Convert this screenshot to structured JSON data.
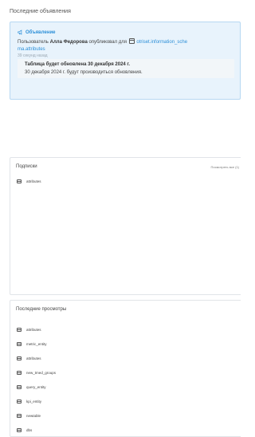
{
  "recent_announcements": {
    "title": "Последние объявления",
    "announcement": {
      "label": "Объявление",
      "prefix": "Пользователь",
      "user": "Алла Федорова",
      "action": "опубликовал для",
      "target_line1": "otriset.information_sche",
      "target_line2": "ma.attributes",
      "time": "39 секунд назад",
      "notice_title": "Таблица будет обновлена 30 декабря 2024 г.",
      "notice_text": "30 декабря 2024 г. будут производиться обновления."
    }
  },
  "subscriptions": {
    "title": "Подписки",
    "view_all": "Посмотреть все (1)",
    "items": [
      {
        "label": "attributes",
        "icon": "table-icon"
      }
    ]
  },
  "recent_views": {
    "title": "Последние просмотры",
    "items": [
      {
        "label": "attributes",
        "icon": "table-icon"
      },
      {
        "label": "metric_entity",
        "icon": "table-icon"
      },
      {
        "label": "attributes",
        "icon": "table-icon"
      },
      {
        "label": "new_tmed_groups",
        "icon": "table-icon"
      },
      {
        "label": "query_entity",
        "icon": "table-icon"
      },
      {
        "label": "kpi_entity",
        "icon": "table-icon"
      },
      {
        "label": "newtable",
        "icon": "table-icon"
      },
      {
        "label": "dbs",
        "icon": "table-icon"
      }
    ]
  },
  "colors": {
    "accent": "#2c8fd8",
    "announce_bg": "#e8f3fc",
    "announce_border": "#b7d8f2"
  }
}
